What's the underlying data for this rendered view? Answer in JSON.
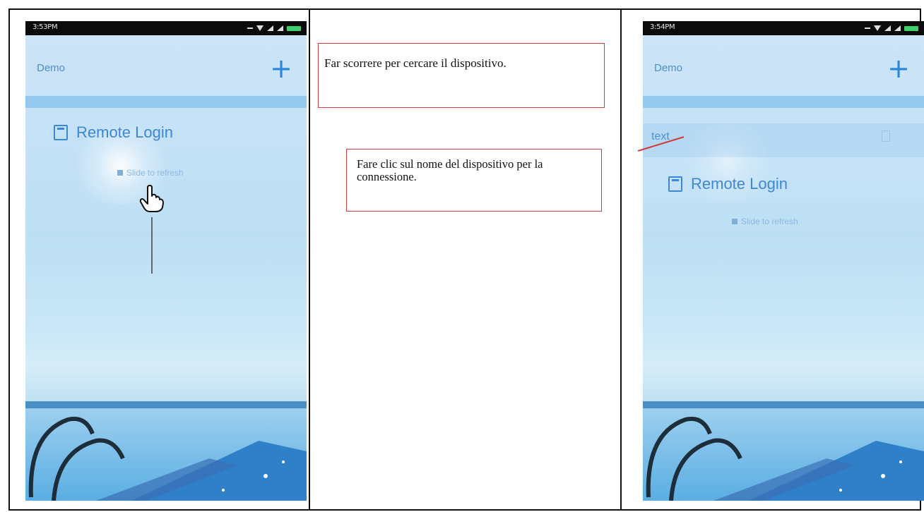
{
  "left_phone": {
    "status_time": "3:53PM",
    "app_title": "Demo",
    "add_label": "+",
    "device_name": "Remote Login",
    "slide_hint": "Slide to refresh",
    "gesture_icon": "pointing-hand-icon"
  },
  "callouts": {
    "slide_text": "Far scorrere per cercare il dispositivo.",
    "click_text": "Fare clic sul nome del dispositivo per la connessione."
  },
  "right_phone": {
    "status_time": "3:54PM",
    "app_title": "Demo",
    "add_label": "+",
    "text_row_label": "text",
    "device_name": "Remote Login",
    "slide_hint": "Slide to refresh"
  },
  "colors": {
    "accent_blue": "#3e87d4",
    "callout_border": "#d23c3c",
    "battery_green": "#3fd06b"
  }
}
